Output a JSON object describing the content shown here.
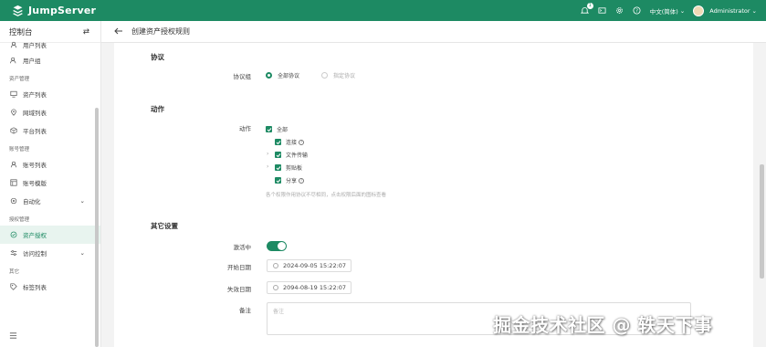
{
  "brand": {
    "name": "JumpServer",
    "color": "#1d8a63"
  },
  "topbar": {
    "notification_count": "1",
    "language": "中文(简体)",
    "user": "Administrator"
  },
  "sidebar": {
    "title": "控制台",
    "items_top": [
      {
        "label": "用户列表",
        "icon": "user-icon"
      },
      {
        "label": "用户组",
        "icon": "user-group-icon"
      }
    ],
    "groups": [
      {
        "label": "资产管理",
        "items": [
          {
            "label": "资产列表",
            "icon": "monitor-icon"
          },
          {
            "label": "网域列表",
            "icon": "location-icon"
          },
          {
            "label": "平台列表",
            "icon": "cube-icon"
          }
        ]
      },
      {
        "label": "账号管理",
        "items": [
          {
            "label": "账号列表",
            "icon": "user-icon"
          },
          {
            "label": "账号模版",
            "icon": "template-icon"
          },
          {
            "label": "自动化",
            "icon": "automation-icon"
          }
        ]
      },
      {
        "label": "授权管理",
        "items": [
          {
            "label": "资产授权",
            "icon": "shield-icon"
          },
          {
            "label": "访问控制",
            "icon": "control-icon"
          }
        ]
      },
      {
        "label": "其它",
        "items": [
          {
            "label": "标签列表",
            "icon": "tag-icon"
          }
        ]
      }
    ]
  },
  "header": {
    "title": "创建资产授权规则"
  },
  "form": {
    "protocol_section": "协议",
    "protocol_group_label": "协议组",
    "protocol_all": "全部协议",
    "protocol_specific": "指定协议",
    "action_section": "动作",
    "action_label": "动作",
    "actions": {
      "all": "全部",
      "connect": "连接",
      "file_transfer": "文件传输",
      "clipboard": "剪贴板",
      "share": "分享"
    },
    "action_hint": "各个权限作用协议不尽相同，点击权限后面的图标查看",
    "other_section": "其它设置",
    "active_label": "激活中",
    "start_label": "开始日期",
    "start_value": "2024-09-05 15:22:07",
    "end_label": "失效日期",
    "end_value": "2094-08-19 15:22:07",
    "comment_label": "备注",
    "comment_placeholder": "备注"
  },
  "watermark": "掘金技术社区 @ 轶天下事"
}
